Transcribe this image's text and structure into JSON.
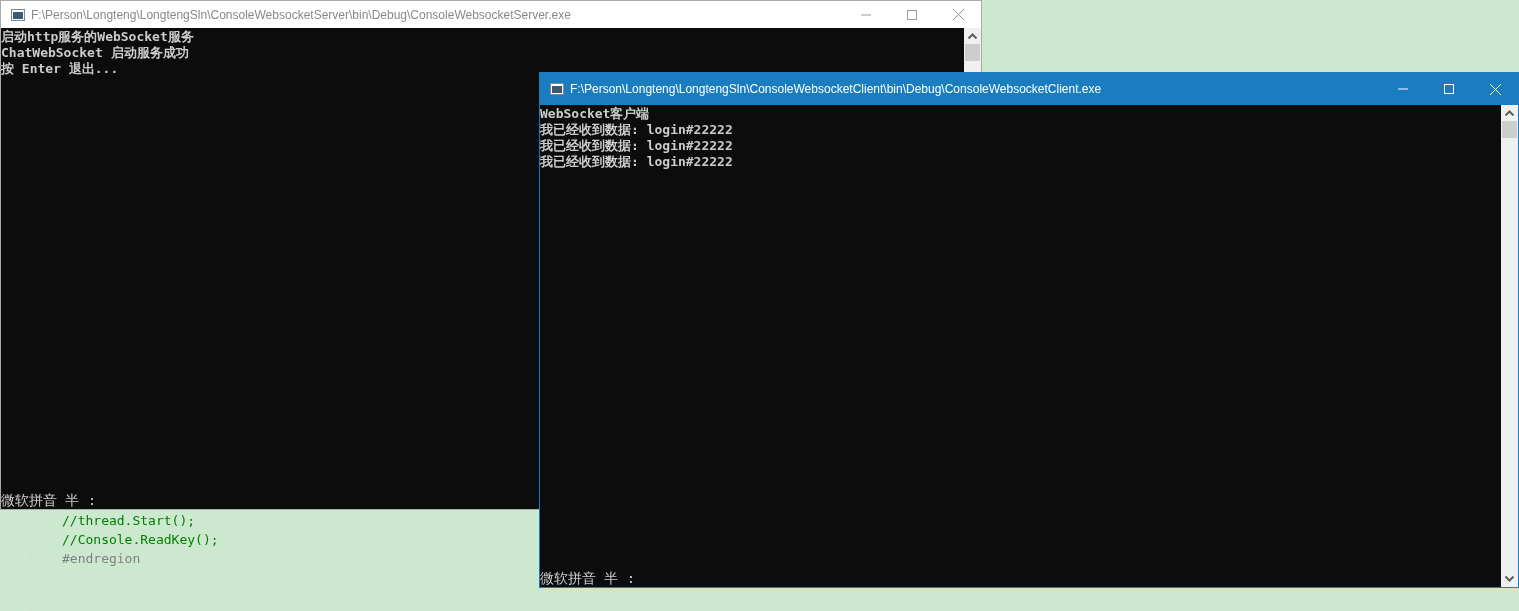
{
  "editor_lines": [
    {
      "text": "//thread.Start();",
      "kind": "comment"
    },
    {
      "text": "//Console.ReadKey();",
      "kind": "comment"
    },
    {
      "text": "#endregion",
      "kind": "directive"
    }
  ],
  "windows": [
    {
      "title": "F:\\Person\\Longteng\\LongtengSln\\ConsoleWebsocketServer\\bin\\Debug\\ConsoleWebsocketServer.exe",
      "active": false,
      "lines": [
        "启动http服务的WebSocket服务",
        "ChatWebSocket 启动服务成功",
        "按 Enter 退出..."
      ],
      "ime": "微软拼音 半 :"
    },
    {
      "title": "F:\\Person\\Longteng\\LongtengSln\\ConsoleWebsocketClient\\bin\\Debug\\ConsoleWebsocketClient.exe",
      "active": true,
      "lines": [
        "WebSocket客户端",
        "我已经收到数据: login#22222",
        "我已经收到数据: login#22222",
        "我已经收到数据: login#22222"
      ],
      "ime": "微软拼音 半 :"
    }
  ]
}
